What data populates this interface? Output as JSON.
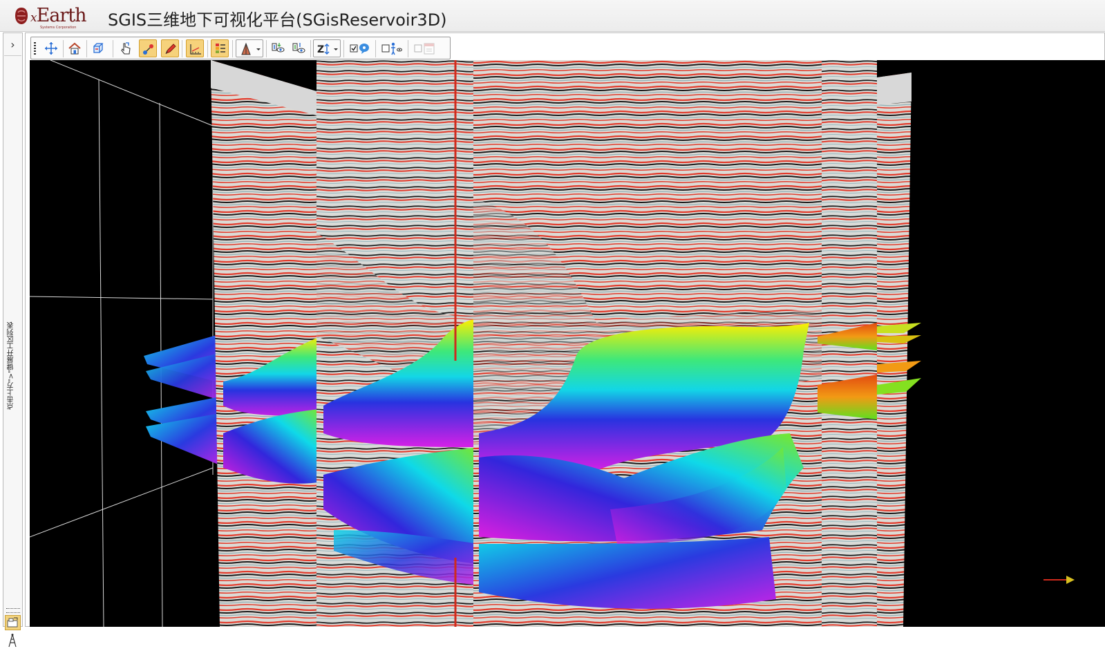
{
  "app": {
    "logo_prefix": "x",
    "logo_name": "Earth",
    "logo_subtitle": "Systems Corporation",
    "title": "SGIS三维地下可视化平台(SGisReservoir3D)"
  },
  "left_panel": {
    "expand_label": "›",
    "collapsed_text": "点击上方\">\"键展开工区列表"
  },
  "toolbar": {
    "buttons": [
      {
        "icon": "pan-arrows-icon"
      },
      {
        "icon": "home-icon"
      },
      {
        "icon": "cube-view-icon"
      },
      {
        "icon": "pointer-hand-icon"
      },
      {
        "icon": "pick-points-icon",
        "active": true
      },
      {
        "icon": "pencil-draw-icon",
        "active": true
      },
      {
        "icon": "axis-grid-icon",
        "active": true
      },
      {
        "icon": "legend-bar-icon",
        "active": true
      },
      {
        "icon": "well-display-dropdown-icon"
      },
      {
        "icon": "eye-well-icon"
      },
      {
        "icon": "eye-layers-icon"
      },
      {
        "icon": "z-scale-dropdown-icon"
      },
      {
        "icon": "tooltip-toggle-icon"
      },
      {
        "icon": "person-eye-icon"
      },
      {
        "icon": "calendar-disabled-icon"
      }
    ],
    "z_label": "Z"
  },
  "colors": {
    "viewport_bg": "#000000",
    "seismic_red": "#e0392b",
    "seismic_dark": "#1b1b1b",
    "active_tool": "#f6d27b"
  }
}
